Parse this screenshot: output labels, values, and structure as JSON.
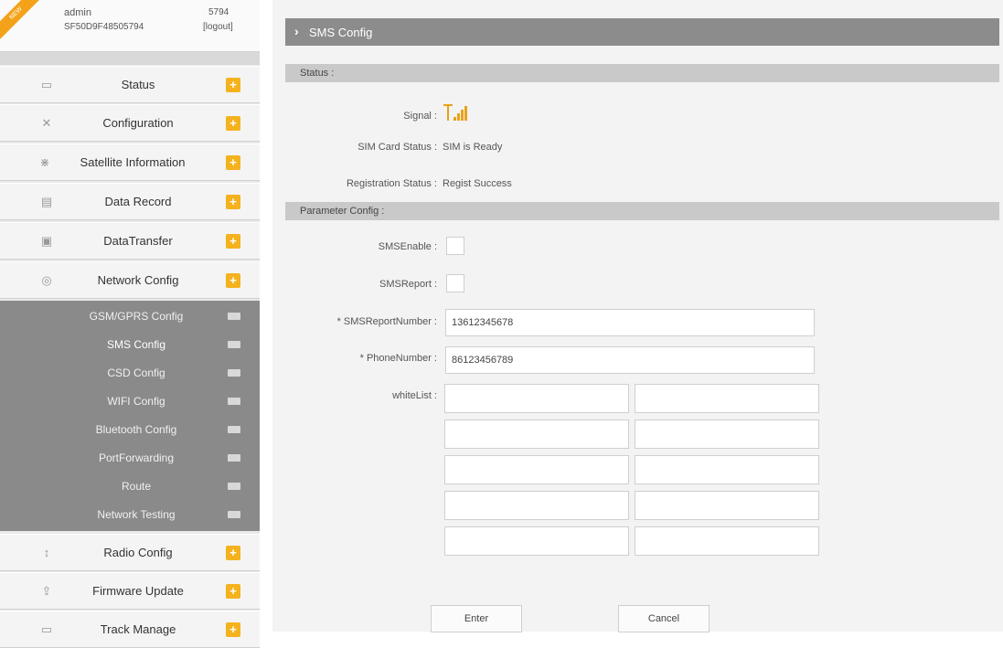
{
  "user": {
    "badge": "NEW",
    "name": "admin",
    "serial": "SF50D9F48505794",
    "number": "5794",
    "logout_label": "[logout]"
  },
  "sidebar": {
    "items": [
      {
        "label": "Status",
        "icon": "monitor-icon"
      },
      {
        "label": "Configuration",
        "icon": "wrench-icon"
      },
      {
        "label": "Satellite Information",
        "icon": "satellite-icon"
      },
      {
        "label": "Data Record",
        "icon": "record-icon"
      },
      {
        "label": "DataTransfer",
        "icon": "transfer-icon"
      },
      {
        "label": "Network Config",
        "icon": "network-icon"
      },
      {
        "label": "Radio Config",
        "icon": "antenna-icon"
      },
      {
        "label": "Firmware Update",
        "icon": "upload-icon"
      },
      {
        "label": "Track Manage",
        "icon": "track-icon"
      }
    ],
    "network_submenu": [
      {
        "label": "GSM/GPRS Config"
      },
      {
        "label": "SMS Config",
        "active": true
      },
      {
        "label": "CSD Config"
      },
      {
        "label": "WIFI Config"
      },
      {
        "label": "Bluetooth Config"
      },
      {
        "label": "PortForwarding"
      },
      {
        "label": "Route"
      },
      {
        "label": "Network Testing"
      }
    ]
  },
  "main": {
    "title": "SMS Config",
    "status": {
      "header": "Status :",
      "signal_label": "Signal :",
      "sim_label": "SIM Card Status :",
      "sim_value": "SIM is Ready",
      "reg_label": "Registration Status :",
      "reg_value": "Regist Success"
    },
    "params": {
      "header": "Parameter Config :",
      "sms_enable_label": "SMSEnable :",
      "sms_report_label": "SMSReport :",
      "sms_report_number_label": "* SMSReportNumber :",
      "sms_report_number_value": "13612345678",
      "phone_number_label": "* PhoneNumber :",
      "phone_number_value": "86123456789",
      "whitelist_label": "whiteList :"
    },
    "buttons": {
      "enter": "Enter",
      "cancel": "Cancel"
    }
  },
  "colors": {
    "accent": "#f4b21e",
    "title_bar": "#8c8c8c",
    "submenu_bg": "#8a8a8a",
    "section_bar": "#c9c9c9"
  }
}
